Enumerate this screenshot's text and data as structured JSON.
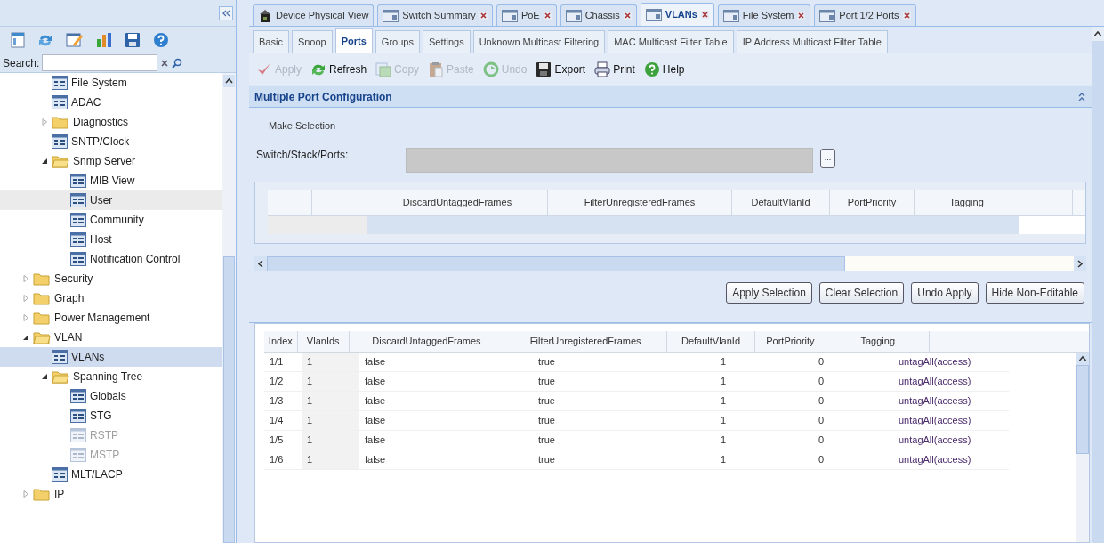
{
  "sidebar": {
    "search": {
      "label": "Search:"
    },
    "tree": {
      "continued": [
        {
          "label": "File System",
          "kind": "page",
          "selected": false,
          "hovered": false,
          "disabled": false
        },
        {
          "label": "ADAC",
          "kind": "page",
          "selected": false,
          "hovered": false,
          "disabled": false
        },
        {
          "label": "Diagnostics",
          "kind": "folder",
          "expanded": false,
          "selected": false,
          "hovered": false,
          "disabled": false
        },
        {
          "label": "SNTP/Clock",
          "kind": "page",
          "selected": false,
          "hovered": false,
          "disabled": false
        },
        {
          "label": "Snmp Server",
          "kind": "folder",
          "expanded": true,
          "selected": false,
          "hovered": false,
          "disabled": false,
          "children": [
            {
              "label": "MIB View",
              "kind": "page",
              "selected": false,
              "hovered": false,
              "disabled": false
            },
            {
              "label": "User",
              "kind": "page",
              "selected": false,
              "hovered": true,
              "disabled": false
            },
            {
              "label": "Community",
              "kind": "page",
              "selected": false,
              "hovered": false,
              "disabled": false
            },
            {
              "label": "Host",
              "kind": "page",
              "selected": false,
              "hovered": false,
              "disabled": false
            },
            {
              "label": "Notification Control",
              "kind": "page",
              "selected": false,
              "hovered": false,
              "disabled": false
            }
          ]
        }
      ],
      "items": [
        {
          "label": "Security",
          "kind": "folder",
          "expanded": false,
          "selected": false,
          "hovered": false,
          "disabled": false
        },
        {
          "label": "Graph",
          "kind": "folder",
          "expanded": false,
          "selected": false,
          "hovered": false,
          "disabled": false
        },
        {
          "label": "Power Management",
          "kind": "folder",
          "expanded": false,
          "selected": false,
          "hovered": false,
          "disabled": false
        },
        {
          "label": "VLAN",
          "kind": "folder",
          "expanded": true,
          "selected": false,
          "hovered": false,
          "disabled": false,
          "children": [
            {
              "label": "VLANs",
              "kind": "page",
              "selected": true,
              "hovered": false,
              "disabled": false
            },
            {
              "label": "Spanning Tree",
              "kind": "folder",
              "expanded": true,
              "selected": false,
              "hovered": false,
              "disabled": false,
              "children": [
                {
                  "label": "Globals",
                  "kind": "page",
                  "selected": false,
                  "hovered": false,
                  "disabled": false
                },
                {
                  "label": "STG",
                  "kind": "page",
                  "selected": false,
                  "hovered": false,
                  "disabled": false
                },
                {
                  "label": "RSTP",
                  "kind": "page",
                  "selected": false,
                  "hovered": false,
                  "disabled": true
                },
                {
                  "label": "MSTP",
                  "kind": "page",
                  "selected": false,
                  "hovered": false,
                  "disabled": true
                }
              ]
            },
            {
              "label": "MLT/LACP",
              "kind": "page",
              "selected": false,
              "hovered": false,
              "disabled": false
            }
          ]
        },
        {
          "label": "IP",
          "kind": "folder",
          "expanded": false,
          "selected": false,
          "hovered": false,
          "disabled": false
        }
      ]
    }
  },
  "doc_tabs": [
    {
      "label": "Device Physical View",
      "kind": "device",
      "closable": false,
      "selected": false
    },
    {
      "label": "Switch Summary",
      "kind": "page",
      "closable": true,
      "selected": false
    },
    {
      "label": "PoE",
      "kind": "page",
      "closable": true,
      "selected": false
    },
    {
      "label": "Chassis",
      "kind": "page",
      "closable": true,
      "selected": false
    },
    {
      "label": "VLANs",
      "kind": "page",
      "closable": true,
      "selected": true
    },
    {
      "label": "File System",
      "kind": "page",
      "closable": true,
      "selected": false
    },
    {
      "label": "Port 1/2 Ports",
      "kind": "page",
      "closable": true,
      "selected": false
    }
  ],
  "sub_tabs": [
    {
      "label": "Basic",
      "selected": false
    },
    {
      "label": "Snoop",
      "selected": false
    },
    {
      "label": "Ports",
      "selected": true
    },
    {
      "label": "Groups",
      "selected": false
    },
    {
      "label": "Settings",
      "selected": false
    },
    {
      "label": "Unknown Multicast Filtering",
      "selected": false
    },
    {
      "label": "MAC Multicast Filter Table",
      "selected": false
    },
    {
      "label": "IP Address Multicast Filter Table",
      "selected": false
    }
  ],
  "toolbar": [
    {
      "label": "Apply",
      "kind": "apply",
      "disabled": true
    },
    {
      "label": "Refresh",
      "kind": "refresh",
      "disabled": false
    },
    {
      "label": "Copy",
      "kind": "copy",
      "disabled": true
    },
    {
      "label": "Paste",
      "kind": "paste",
      "disabled": true
    },
    {
      "label": "Undo",
      "kind": "undo",
      "disabled": true
    },
    {
      "label": "Export",
      "kind": "export",
      "disabled": false
    },
    {
      "label": "Print",
      "kind": "print",
      "disabled": false
    },
    {
      "label": "Help",
      "kind": "help",
      "disabled": false
    }
  ],
  "panel": {
    "title": "Multiple Port Configuration",
    "selection": {
      "legend": "Make Selection",
      "field_label": "Switch/Stack/Ports:",
      "browse_button": "..."
    },
    "selection_grid": {
      "columns": [
        "DiscardUntaggedFrames",
        "FilterUnregisteredFrames",
        "DefaultVlanId",
        "PortPriority",
        "Tagging"
      ]
    },
    "actions": [
      "Apply Selection",
      "Clear Selection",
      "Undo Apply",
      "Hide Non-Editable"
    ]
  },
  "table": {
    "columns": [
      "Index",
      "VlanIds",
      "DiscardUntaggedFrames",
      "FilterUnregisteredFrames",
      "DefaultVlanId",
      "PortPriority",
      "Tagging"
    ],
    "rows": [
      [
        "1/1",
        "1",
        "false",
        "true",
        "1",
        "0",
        "untagAll(access)"
      ],
      [
        "1/2",
        "1",
        "false",
        "true",
        "1",
        "0",
        "untagAll(access)"
      ],
      [
        "1/3",
        "1",
        "false",
        "true",
        "1",
        "0",
        "untagAll(access)"
      ],
      [
        "1/4",
        "1",
        "false",
        "true",
        "1",
        "0",
        "untagAll(access)"
      ],
      [
        "1/5",
        "1",
        "false",
        "true",
        "1",
        "0",
        "untagAll(access)"
      ],
      [
        "1/6",
        "1",
        "false",
        "true",
        "1",
        "0",
        "untagAll(access)"
      ]
    ]
  }
}
